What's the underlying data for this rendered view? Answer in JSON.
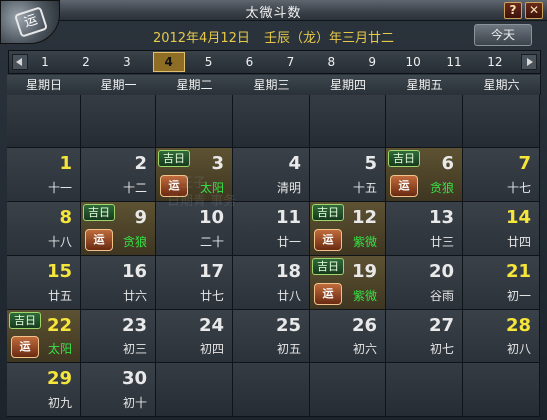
{
  "window": {
    "title": "太微斗数",
    "help_label": "?",
    "close_label": "✕",
    "emblem_text": "运"
  },
  "header": {
    "solar_date": "2012年4月12日",
    "lunar_date": "壬辰（龙）年三月廿二",
    "today_label": "今天"
  },
  "months": [
    "1",
    "2",
    "3",
    "4",
    "5",
    "6",
    "7",
    "8",
    "9",
    "10",
    "11",
    "12"
  ],
  "selected_month_index": 3,
  "weekdays": [
    "星期日",
    "星期一",
    "星期二",
    "星期三",
    "星期四",
    "星期五",
    "星期六"
  ],
  "watermark": [
    "小王子",
    "日期青 事务"
  ],
  "badges": {
    "lucky": "吉日",
    "fortune": "运"
  },
  "colors": {
    "date_gold": "#e7c94a",
    "weekend_yellow": "#f6e53b",
    "green_text": "#37e247"
  },
  "rows": [
    [
      null,
      null,
      null,
      null,
      null,
      null,
      null
    ],
    [
      {
        "day": "1",
        "lunar": "十一"
      },
      {
        "day": "2",
        "lunar": "十二"
      },
      {
        "day": "3",
        "lunar": "太阳",
        "lucky": true
      },
      {
        "day": "4",
        "lunar": "清明"
      },
      {
        "day": "5",
        "lunar": "十五"
      },
      {
        "day": "6",
        "lunar": "贪狼",
        "lucky": true
      },
      {
        "day": "7",
        "lunar": "十七"
      }
    ],
    [
      {
        "day": "8",
        "lunar": "十八"
      },
      {
        "day": "9",
        "lunar": "贪狼",
        "lucky": true
      },
      {
        "day": "10",
        "lunar": "二十"
      },
      {
        "day": "11",
        "lunar": "廿一"
      },
      {
        "day": "12",
        "lunar": "紫微",
        "lucky": true
      },
      {
        "day": "13",
        "lunar": "廿三"
      },
      {
        "day": "14",
        "lunar": "廿四"
      }
    ],
    [
      {
        "day": "15",
        "lunar": "廿五"
      },
      {
        "day": "16",
        "lunar": "廿六"
      },
      {
        "day": "17",
        "lunar": "廿七"
      },
      {
        "day": "18",
        "lunar": "廿八"
      },
      {
        "day": "19",
        "lunar": "紫微",
        "lucky": true
      },
      {
        "day": "20",
        "lunar": "谷雨"
      },
      {
        "day": "21",
        "lunar": "初一"
      }
    ],
    [
      {
        "day": "22",
        "lunar": "太阳",
        "lucky": true
      },
      {
        "day": "23",
        "lunar": "初三"
      },
      {
        "day": "24",
        "lunar": "初四"
      },
      {
        "day": "25",
        "lunar": "初五"
      },
      {
        "day": "26",
        "lunar": "初六"
      },
      {
        "day": "27",
        "lunar": "初七"
      },
      {
        "day": "28",
        "lunar": "初八"
      }
    ],
    [
      {
        "day": "29",
        "lunar": "初九"
      },
      {
        "day": "30",
        "lunar": "初十"
      },
      null,
      null,
      null,
      null,
      null
    ]
  ]
}
